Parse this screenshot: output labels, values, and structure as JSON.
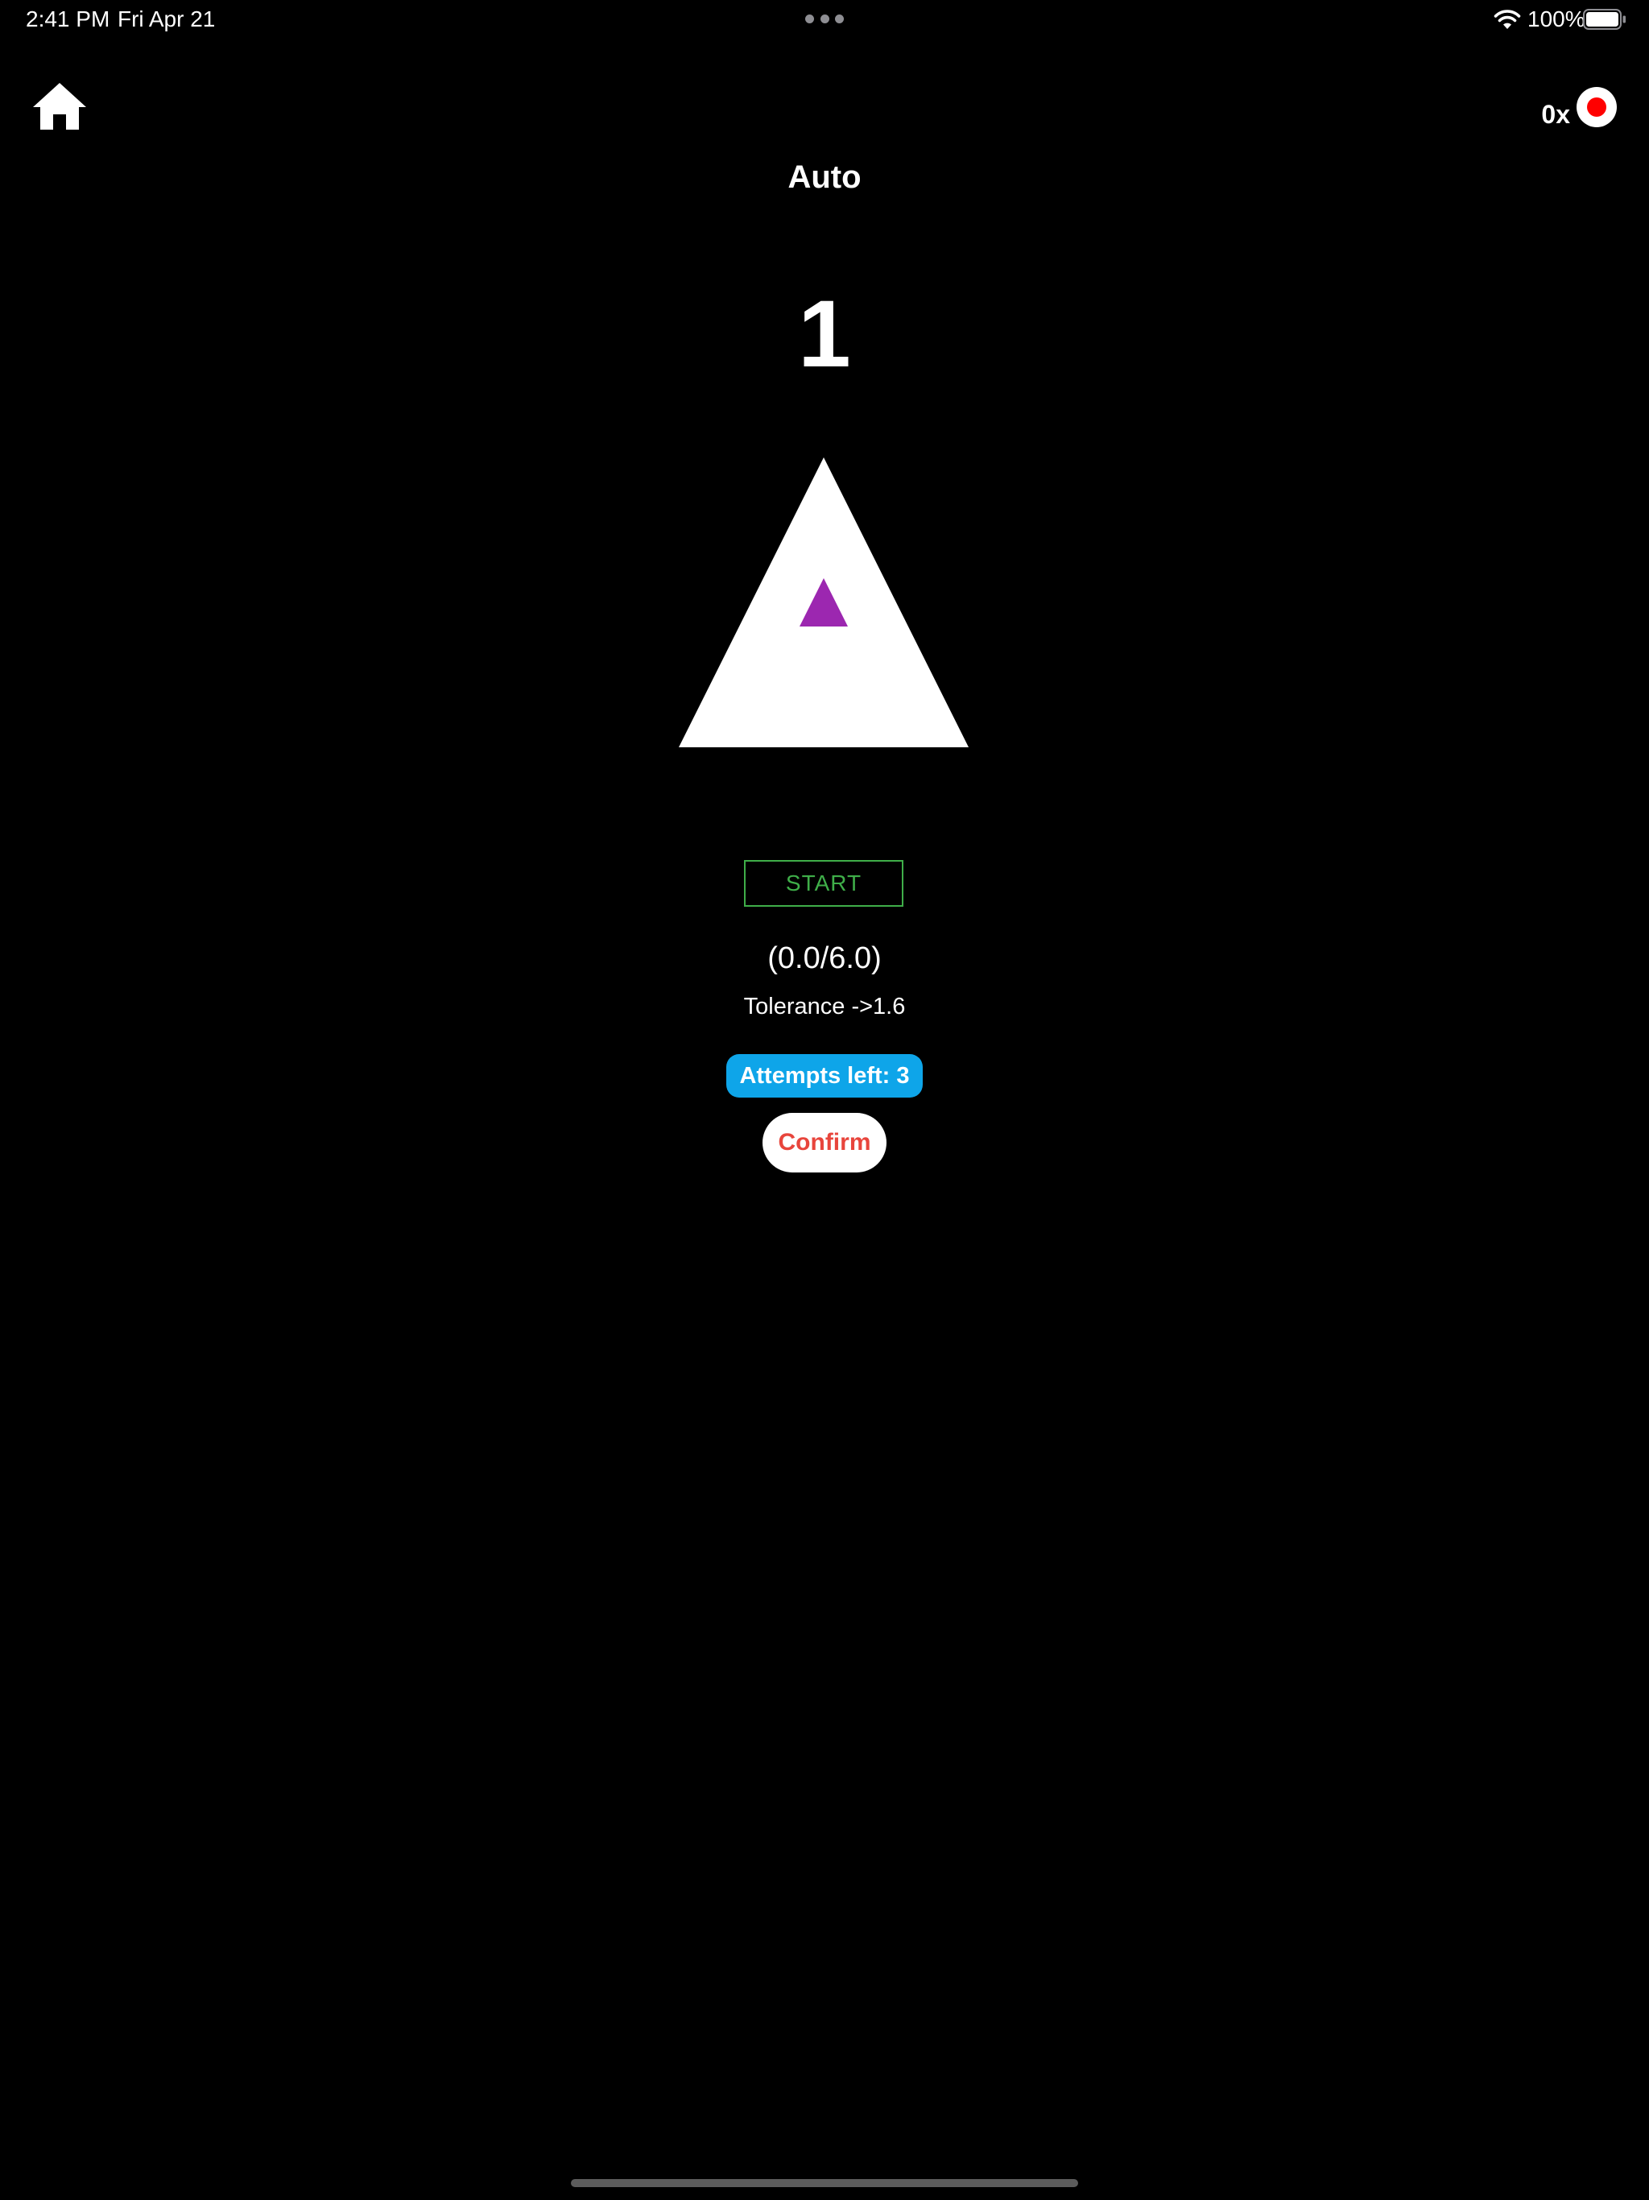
{
  "status_bar": {
    "time": "2:41 PM",
    "date": "Fri Apr 21",
    "battery_percent": "100%",
    "icons": [
      "multitask-dots-icon",
      "wifi-icon",
      "battery-icon"
    ]
  },
  "top_bar": {
    "home_icon": "home-icon",
    "speed_label": "0x",
    "record_icon": "record-icon",
    "record_color": "#ff0000"
  },
  "main": {
    "title": "Auto",
    "level_number": "1",
    "outer_shape": "triangle",
    "outer_shape_color": "#ffffff",
    "inner_shape": "triangle",
    "inner_shape_color": "#9c27b0",
    "start_label": "START",
    "start_color": "#3fae49",
    "progress": "(0.0/6.0)",
    "tolerance": "Tolerance ->1.6",
    "attempts_label": "Attempts left: 3",
    "attempts_color": "#0ea5e9",
    "confirm_label": "Confirm",
    "confirm_color": "#e8453c"
  }
}
